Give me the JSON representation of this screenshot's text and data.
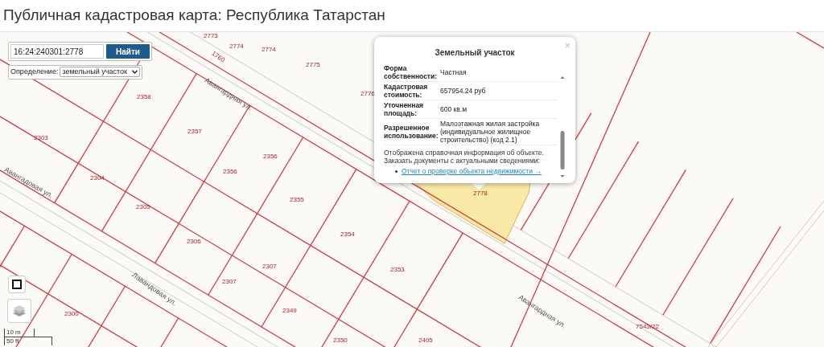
{
  "page": {
    "title": "Публичная кадастровая карта: Республика Татарстан"
  },
  "search": {
    "value": "16:24:240301:2778",
    "button": "Найти"
  },
  "definition": {
    "label": "Определение:",
    "value": "земельный участок"
  },
  "map": {
    "parcels": [
      "2773",
      "2774",
      "2774",
      "1760",
      "2775",
      "2776",
      "2358",
      "2357",
      "2356",
      "2356",
      "2303",
      "2304",
      "2305",
      "2306",
      "2355",
      "2354",
      "2307",
      "2307",
      "2353",
      "2349",
      "2300",
      "2405",
      "7543/22",
      "2778",
      "2350"
    ],
    "streets": [
      "Авангардная ул.",
      "Авангардная ул.",
      "Авангадовая ул.",
      "Лавандовая ул."
    ]
  },
  "popup": {
    "title": "Земельный участок",
    "close": "×",
    "rows": [
      {
        "label": "Форма собственности:",
        "value": "Частная"
      },
      {
        "label": "Кадастровая стоимость:",
        "value": "657954.24 руб"
      },
      {
        "label": "Уточненная площадь:",
        "value": "600 кв.м"
      },
      {
        "label": "Разрешенное использование:",
        "value": "Малоэтажная жилая застройка (индивидуальное жилищное строительство) (код 2.1)"
      }
    ],
    "note": "Отображена справочная информация об объекте. Заказать документы с актуальными сведениями:",
    "links": [
      "Отчет о проверке объекта недвижимости →"
    ]
  },
  "scale": {
    "metric": "10 m",
    "imperial": "50 ft"
  }
}
